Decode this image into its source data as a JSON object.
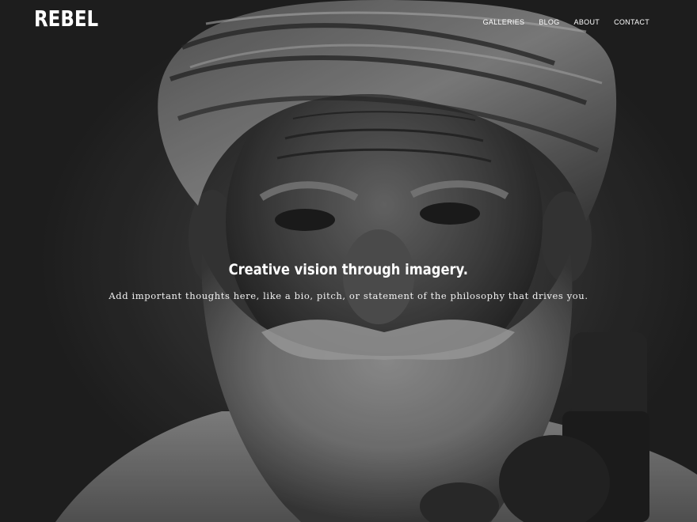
{
  "site": {
    "logo": "REBEL"
  },
  "nav": {
    "items": [
      {
        "label": "GALLERIES"
      },
      {
        "label": "BLOG"
      },
      {
        "label": "ABOUT"
      },
      {
        "label": "CONTACT"
      }
    ]
  },
  "hero": {
    "title": "Creative vision through imagery.",
    "subtitle": "Add important thoughts here, like a bio, pitch, or statement of the philosophy that drives you.",
    "image_description_icon": "portrait-photo"
  }
}
